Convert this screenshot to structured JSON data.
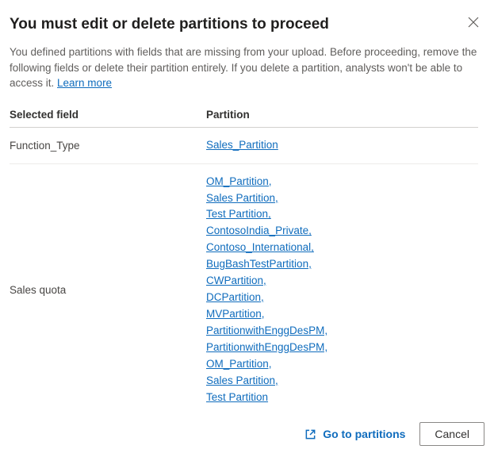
{
  "title": "You must edit or delete partitions to proceed",
  "description_pre": "You defined partitions with fields that are missing from your upload. Before proceeding, remove the following fields or delete their partition entirely. If you delete a partition, analysts won't be able to access it. ",
  "learn_more_label": "Learn more",
  "headers": {
    "field": "Selected field",
    "partition": "Partition"
  },
  "rows": [
    {
      "field": "Function_Type",
      "partitions": [
        "Sales_Partition"
      ]
    },
    {
      "field": "Sales quota",
      "partitions": [
        "OM_Partition,",
        "Sales Partition,",
        "Test Partition,",
        "ContosoIndia_Private,",
        "Contoso_International,",
        "BugBashTestPartition,",
        "CWPartition,",
        "DCPartition,",
        "MVPartition,",
        "PartitionwithEnggDesPM,",
        "PartitionwithEnggDesPM,",
        "OM_Partition,",
        "Sales Partition,",
        "Test Partition"
      ]
    }
  ],
  "footer": {
    "go_to_partitions": "Go to partitions",
    "cancel": "Cancel"
  }
}
